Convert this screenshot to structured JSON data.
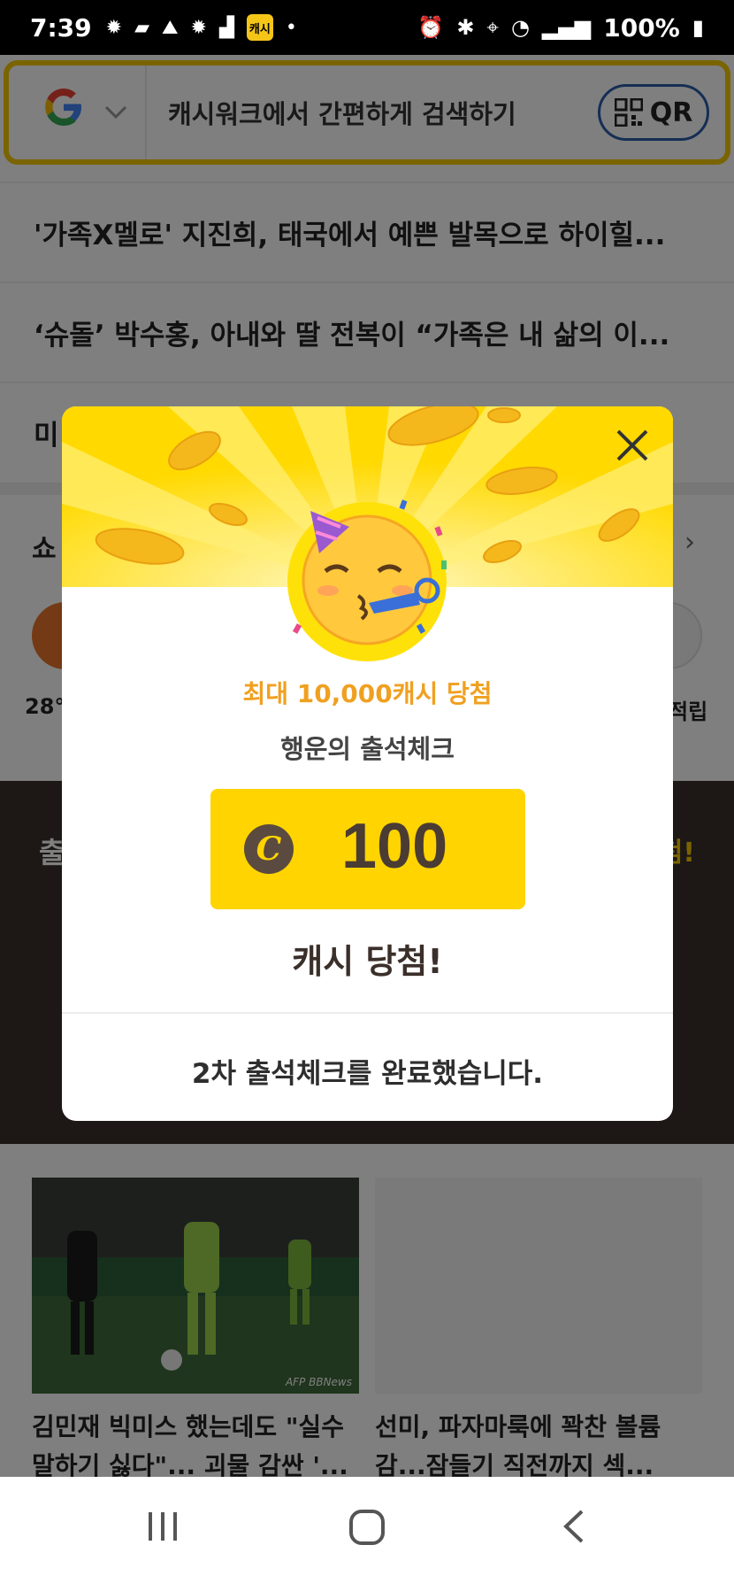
{
  "status_bar": {
    "time": "7:39",
    "battery": "100%",
    "app_badge": "캐시"
  },
  "search": {
    "google_letter": "G",
    "placeholder": "캐시워크에서 간편하게 검색하기",
    "qr_label": "QR"
  },
  "news": [
    "'가족X멜로' 지진희, 태국에서 예쁜 발목으로 하이힐...",
    "‘슈돌’ 박수홍, 아내와 딸 전복이 “가족은 내 삶의 이...",
    "미"
  ],
  "shopping": {
    "title": "쇼",
    "left_label": "28°",
    "right_label": "적립"
  },
  "attendance_band": {
    "left": "출",
    "right": "첨!"
  },
  "cards": [
    {
      "caption": "김민재 빅미스 했는데도 \"실수 말하기 싫다\"... 괴물 감싼 '...",
      "credit": "AFP BBNews"
    },
    {
      "caption": "선미, 파자마룩에 꽉찬 볼륨감...잠들기 직전까지 섹..."
    }
  ],
  "modal": {
    "subtitle": "최대 10,000캐시 당첨",
    "title": "행운의 출석체크",
    "coin_symbol": "C",
    "amount": "100",
    "win_text": "캐시 당첨!",
    "footer": "2차 출석체크를 완료했습니다.",
    "colors": {
      "hero": "#ffd900",
      "accent": "#f0a020",
      "amount_box": "#ffd400"
    }
  }
}
